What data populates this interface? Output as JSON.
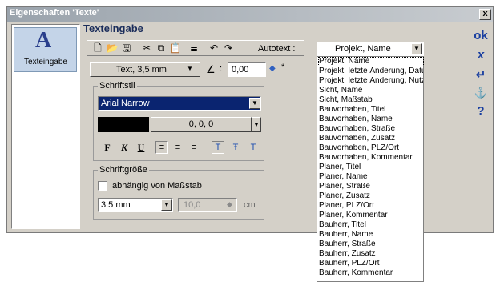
{
  "window": {
    "title": "Eigenschaften 'Texte'",
    "close": "x"
  },
  "left_panel": {
    "icon_letter": "A",
    "label": "Texteingabe"
  },
  "panel": {
    "title": "Texteingabe"
  },
  "toolbar": {
    "autotext_label": "Autotext :",
    "autotext_value": "Projekt, Name"
  },
  "text_style": {
    "value": "Text, 3,5 mm",
    "angle_value": "0,00",
    "angle_label": ":"
  },
  "schriftstil": {
    "label": "Schriftstil",
    "font": "Arial Narrow",
    "color_value": "0, 0, 0",
    "format_bold": "F",
    "format_italic": "K",
    "format_underline": "U"
  },
  "schriftgroesse": {
    "label": "Schriftgröße",
    "checkbox_label": "abhängig von Maßstab",
    "size_value": "3.5 mm",
    "scale_value": "10,0",
    "unit": "cm"
  },
  "right_buttons": {
    "ok": "ok",
    "cancel": "x",
    "apply": "↵",
    "anchor": "⚓",
    "help": "?"
  },
  "autotext_options": [
    "Projekt, Name",
    "Projekt, letzte Änderung, Datu",
    "Projekt, letzte Änderung, Nutze",
    "Sicht, Name",
    "Sicht, Maßstab",
    "Bauvorhaben, Titel",
    "Bauvorhaben, Name",
    "Bauvorhaben, Straße",
    "Bauvorhaben, Zusatz",
    "Bauvorhaben, PLZ/Ort",
    "Bauvorhaben, Kommentar",
    "Planer, Titel",
    "Planer, Name",
    "Planer, Straße",
    "Planer, Zusatz",
    "Planer, PLZ/Ort",
    "Planer, Kommentar",
    "Bauherr, Titel",
    "Bauherr, Name",
    "Bauherr, Straße",
    "Bauherr, Zusatz",
    "Bauherr, PLZ/Ort",
    "Bauherr, Kommentar"
  ]
}
